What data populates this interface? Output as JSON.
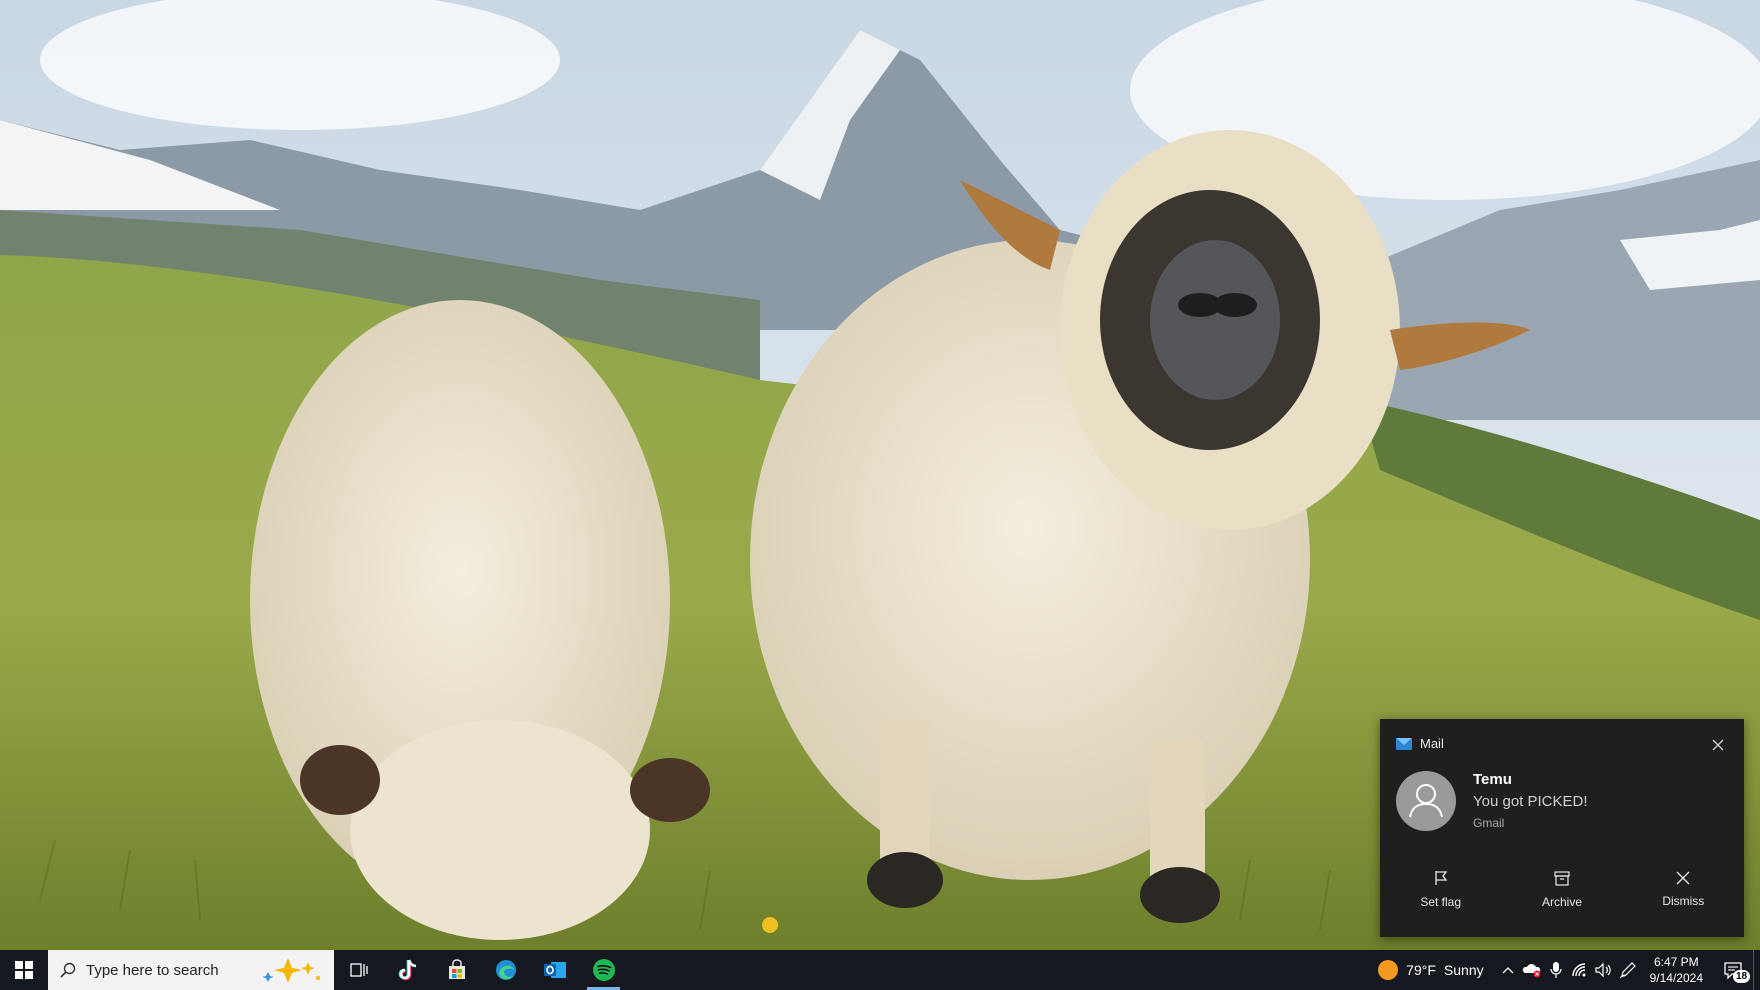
{
  "wallpaper": {
    "description_icon": "sheep-wallpaper"
  },
  "notification": {
    "app_name": "Mail",
    "sender": "Temu",
    "message": "You got PICKED!",
    "source": "Gmail",
    "actions": [
      {
        "label": "Set flag",
        "icon": "flag-icon"
      },
      {
        "label": "Archive",
        "icon": "archive-icon"
      },
      {
        "label": "Dismiss",
        "icon": "close-icon"
      }
    ]
  },
  "taskbar": {
    "search_placeholder": "Type here to search",
    "pinned_apps": [
      "task-view",
      "tiktok",
      "microsoft-store",
      "edge",
      "outlook",
      "spotify"
    ],
    "weather": {
      "temp": "79°F",
      "condition": "Sunny"
    },
    "clock": {
      "time": "6:47 PM",
      "date": "9/14/2024"
    },
    "notification_count": "18"
  },
  "colors": {
    "taskbar_bg": "#15181f",
    "toast_bg": "#1f1f1f",
    "active_indicator": "#7fb0e8",
    "spotify_green": "#1db954"
  }
}
